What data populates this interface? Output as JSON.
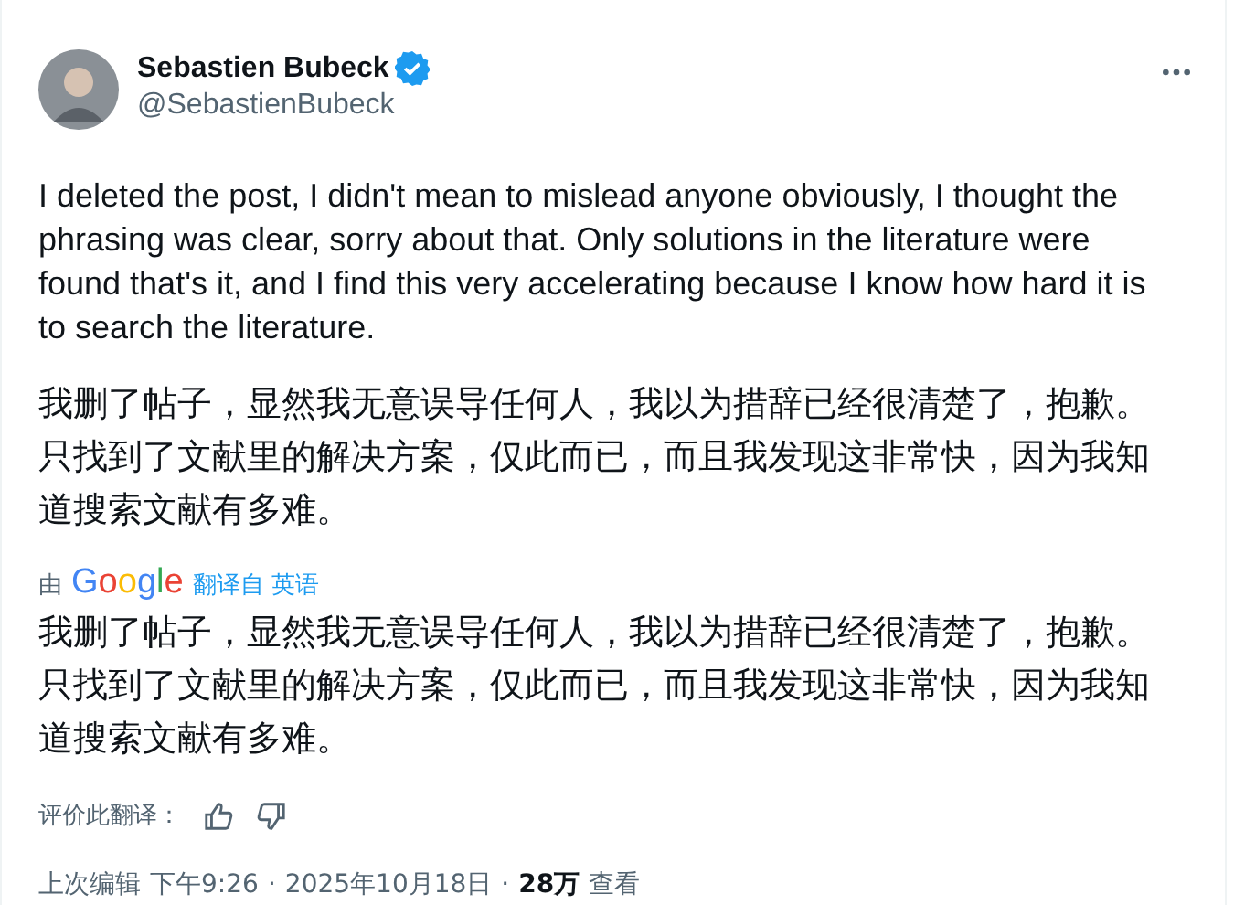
{
  "author": {
    "name": "Sebastien Bubeck",
    "handle": "@SebastienBubeck",
    "verified": true
  },
  "post": {
    "text": "I deleted the post, I didn't mean to mislead anyone obviously, I thought the phrasing was clear, sorry about that. Only solutions in the literature were found that's it, and I find this very accelerating because I know how hard it is to search the literature.",
    "text_zh": "我删了帖子，显然我无意误导任何人，我以为措辞已经很清楚了，抱歉。只找到了文献里的解决方案，仅此而已，而且我发现这非常快，因为我知道搜索文献有多难。"
  },
  "translation": {
    "by": "由",
    "provider": "Google",
    "source_link": "翻译自 英语",
    "text": "我删了帖子，显然我无意误导任何人，我以为措辞已经很清楚了，抱歉。只找到了文献里的解决方案，仅此而已，而且我发现这非常快，因为我知道搜索文献有多难。",
    "rate_label": "评价此翻译："
  },
  "meta": {
    "edited": "上次编辑",
    "time": "下午9:26",
    "date": "2025年10月18日",
    "views": "28万",
    "views_label": "查看",
    "separator": "·"
  }
}
